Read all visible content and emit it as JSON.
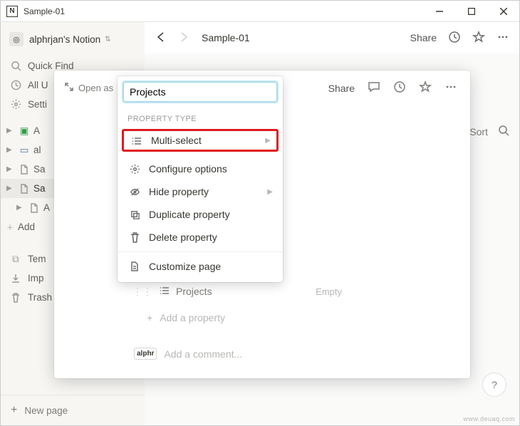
{
  "window": {
    "title": "Sample-01"
  },
  "sidebar": {
    "workspace": "alphrjan's Notion",
    "quickFind": "Quick Find",
    "allUpdates": "All U",
    "settings": "Setti",
    "tree": [
      {
        "label": "A",
        "icon": "checkbox"
      },
      {
        "label": "al",
        "icon": "image"
      },
      {
        "label": "Sa",
        "icon": "page"
      },
      {
        "label": "Sa",
        "icon": "page",
        "selected": true
      },
      {
        "label": "A",
        "icon": "page"
      }
    ],
    "addPage": "Add",
    "bottom": {
      "templates": "Tem",
      "import": "Imp",
      "trash": "Trash"
    },
    "newPage": "New page"
  },
  "topbar": {
    "crumb": "Sample-01",
    "share": "Share",
    "sort": "Sort"
  },
  "overlay": {
    "openAs": "Open as",
    "share": "Share",
    "propRow": {
      "label": "Projects",
      "empty": "Empty"
    },
    "addProperty": "Add a property",
    "commentPlaceholder": "Add a comment...",
    "avatar": "alphr"
  },
  "popup": {
    "inputValue": "Projects",
    "sectionLabel": "PROPERTY TYPE",
    "items": {
      "multiSelect": "Multi-select",
      "configure": "Configure options",
      "hide": "Hide property",
      "duplicate": "Duplicate property",
      "delete": "Delete property",
      "customize": "Customize page"
    }
  },
  "help": "?",
  "watermark": "www.deuaq.com"
}
